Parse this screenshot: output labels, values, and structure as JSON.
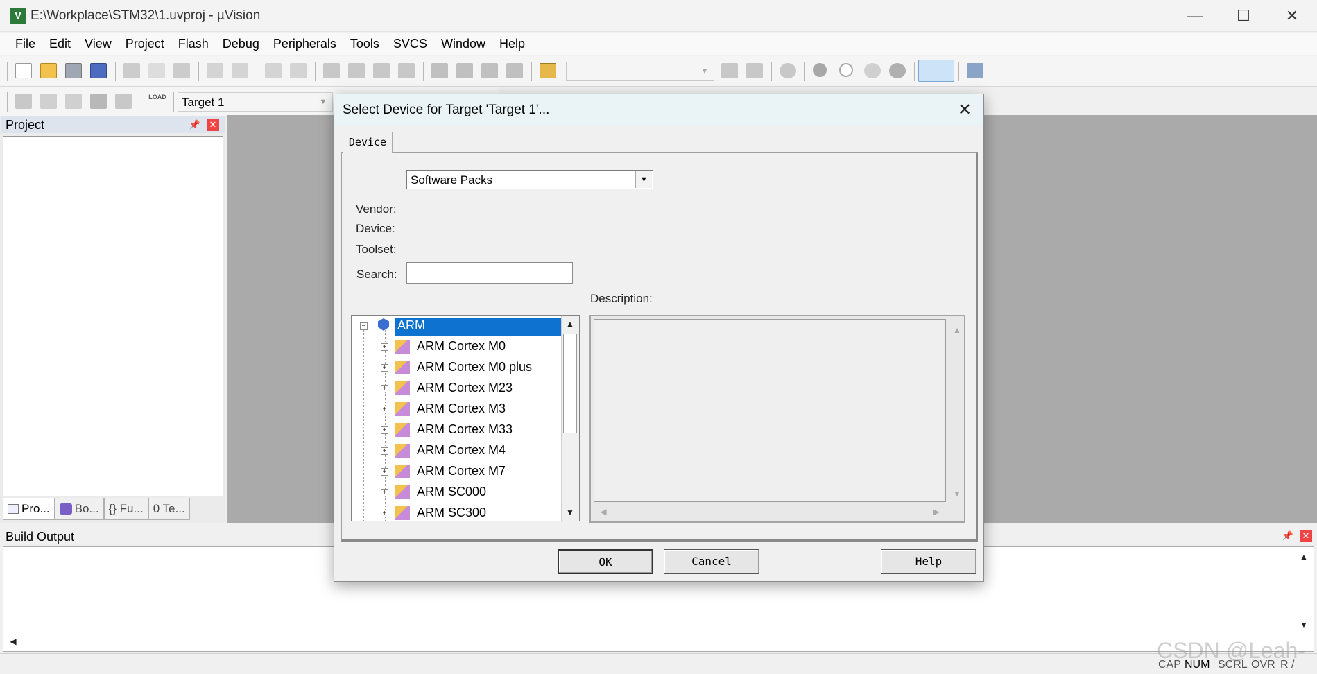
{
  "window": {
    "title": "E:\\Workplace\\STM32\\1.uvproj - µVision",
    "app_icon_text": "V",
    "minimize": "—",
    "maximize": "☐",
    "close": "✕"
  },
  "menu": [
    "File",
    "Edit",
    "View",
    "Project",
    "Flash",
    "Debug",
    "Peripherals",
    "Tools",
    "SVCS",
    "Window",
    "Help"
  ],
  "build_toolbar": {
    "load_label": "LOAD",
    "target_select": "Target 1"
  },
  "project_panel": {
    "title": "Project",
    "tabs": [
      "Pro...",
      "Bo...",
      "{} Fu...",
      "0 Te..."
    ]
  },
  "build_output": {
    "title": "Build Output"
  },
  "status_bar": [
    "CAP",
    "NUM",
    "SCRL",
    "OVR",
    "R /"
  ],
  "watermark": "CSDN @Leah-",
  "dialog": {
    "title": "Select Device for Target 'Target 1'...",
    "close": "✕",
    "tab": "Device",
    "packs_select": "Software Packs",
    "vendor_label": "Vendor:",
    "device_label": "Device:",
    "toolset_label": "Toolset:",
    "search_label": "Search:",
    "search_value": "",
    "description_label": "Description:",
    "tree": {
      "root": "ARM",
      "children": [
        "ARM Cortex M0",
        "ARM Cortex M0 plus",
        "ARM Cortex M23",
        "ARM Cortex M3",
        "ARM Cortex M33",
        "ARM Cortex M4",
        "ARM Cortex M7",
        "ARM SC000",
        "ARM SC300"
      ]
    },
    "buttons": {
      "ok": "OK",
      "cancel": "Cancel",
      "help": "Help"
    }
  },
  "colors": {
    "selection": "#0e72d1",
    "editor_background": "#aaaaaa",
    "dialog_titlebar": "#eaf4f7"
  }
}
